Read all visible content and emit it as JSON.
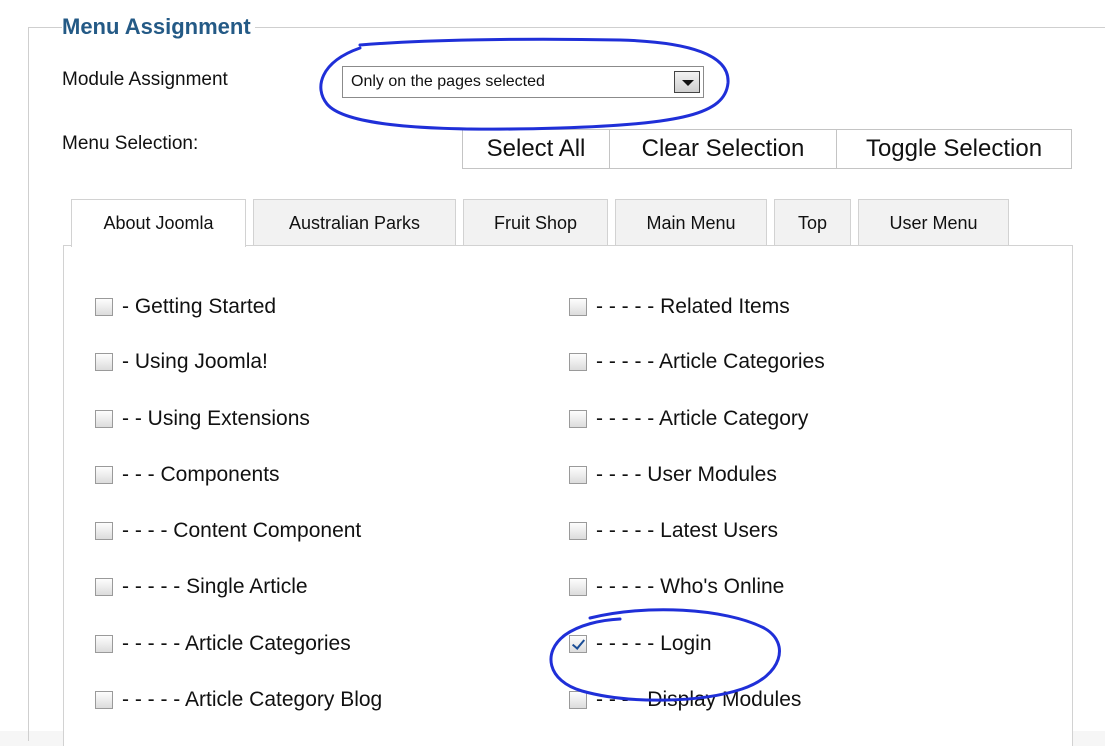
{
  "section": {
    "legend": "Menu Assignment"
  },
  "module_assignment": {
    "label": "Module Assignment",
    "selected": "Only on the pages selected"
  },
  "menu_selection": {
    "label": "Menu Selection:"
  },
  "buttons": {
    "select_all": "Select All",
    "clear": "Clear Selection",
    "toggle": "Toggle Selection"
  },
  "tabs": [
    {
      "label": "About Joomla",
      "active": true
    },
    {
      "label": "Australian Parks"
    },
    {
      "label": "Fruit Shop"
    },
    {
      "label": "Main Menu"
    },
    {
      "label": "Top"
    },
    {
      "label": "User Menu"
    }
  ],
  "left_items": [
    {
      "label": "- Getting Started",
      "checked": false
    },
    {
      "label": "- Using Joomla!",
      "checked": false
    },
    {
      "label": "- - Using Extensions",
      "checked": false
    },
    {
      "label": "- - - Components",
      "checked": false
    },
    {
      "label": "- - - - Content Component",
      "checked": false
    },
    {
      "label": "- - - - - Single Article",
      "checked": false
    },
    {
      "label": "- - - - - Article Categories",
      "checked": false
    },
    {
      "label": "- - - - - Article Category Blog",
      "checked": false
    }
  ],
  "right_items": [
    {
      "label": "- - - - - Related Items",
      "checked": false
    },
    {
      "label": "- - - - - Article Categories",
      "checked": false
    },
    {
      "label": "- - - - - Article Category",
      "checked": false
    },
    {
      "label": "- - - - User Modules",
      "checked": false
    },
    {
      "label": "- - - - - Latest Users",
      "checked": false
    },
    {
      "label": "- - - - - Who's Online",
      "checked": false
    },
    {
      "label": "- - - - - Login",
      "checked": true
    },
    {
      "label": "- - - - Display Modules",
      "checked": false
    }
  ],
  "colors": {
    "legend": "#245a86",
    "annotation": "#1f2fd8"
  }
}
